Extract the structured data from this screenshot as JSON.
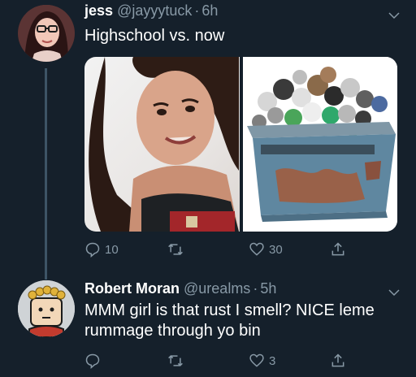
{
  "tweets": [
    {
      "name": "jess",
      "handle": "@jayyytuck",
      "separator": "·",
      "time": "6h",
      "text": "Highschool vs. now",
      "actions": {
        "reply_count": "10",
        "retweet_count": "",
        "like_count": "30"
      }
    },
    {
      "name": "Robert Moran",
      "handle": "@urealms",
      "separator": "·",
      "time": "5h",
      "text": "MMM girl is that rust I smell? NICE leme rummage through yo bin",
      "actions": {
        "reply_count": "",
        "retweet_count": "",
        "like_count": "3"
      }
    }
  ],
  "colors": {
    "background": "#15202b",
    "muted_text": "#8899a6",
    "thread_line": "#3d5466"
  },
  "icons": [
    "reply-icon",
    "retweet-icon",
    "like-icon",
    "share-icon",
    "chevron-down-icon"
  ]
}
